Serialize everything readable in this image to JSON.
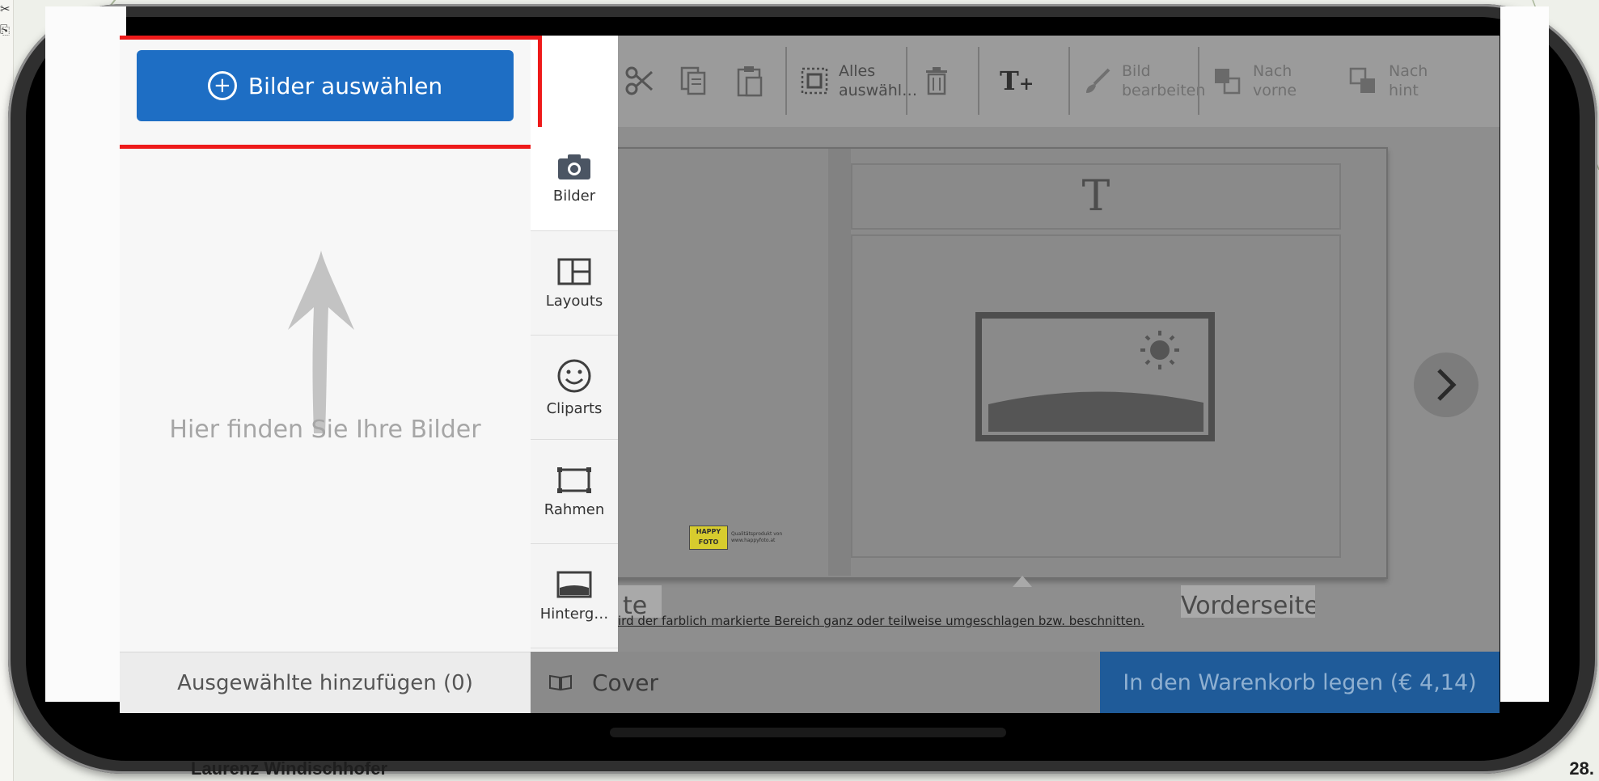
{
  "slide": {
    "footer_author": "Laurenz Windischhofer",
    "footer_page": "28."
  },
  "select_images_button": "Bilder auswählen",
  "images_panel": {
    "empty_hint": "Hier finden Sie Ihre Bilder",
    "add_selected": "Ausgewählte hinzufügen (0)"
  },
  "tool_tabs": [
    {
      "label": "Bilder",
      "icon": "camera-icon"
    },
    {
      "label": "Layouts",
      "icon": "layout-icon"
    },
    {
      "label": "Cliparts",
      "icon": "smiley-icon"
    },
    {
      "label": "Rahmen",
      "icon": "frame-icon"
    },
    {
      "label": "Hinterg…",
      "icon": "background-icon"
    }
  ],
  "toolbar": {
    "select_all_line1": "Alles",
    "select_all_line2": "auswähl…",
    "edit_image_line1": "Bild",
    "edit_image_line2": "bearbeiten",
    "to_front_line1": "Nach",
    "to_front_line2": "vorne",
    "to_back_line1": "Nach",
    "to_back_line2": "hint"
  },
  "canvas": {
    "title_placeholder": "T",
    "back_label": "te",
    "front_label": "Vorderseite",
    "notice": "ird der farblich markierte Bereich ganz oder teilweise umgeschlagen bzw. beschnitten.",
    "logo_line1": "HAPPY",
    "logo_line2": "FOTO",
    "logo_caption1": "Qualitätsprodukt von",
    "logo_caption2": "www.happyfoto.at"
  },
  "bottom_bar": {
    "cover_label": "Cover",
    "cart_button": "In den Warenkorb legen (€ 4,14)"
  },
  "colors": {
    "primary_button": "#1e6ec4",
    "highlight_box": "#ee1a1a",
    "cart_button": "#1f5b99"
  }
}
